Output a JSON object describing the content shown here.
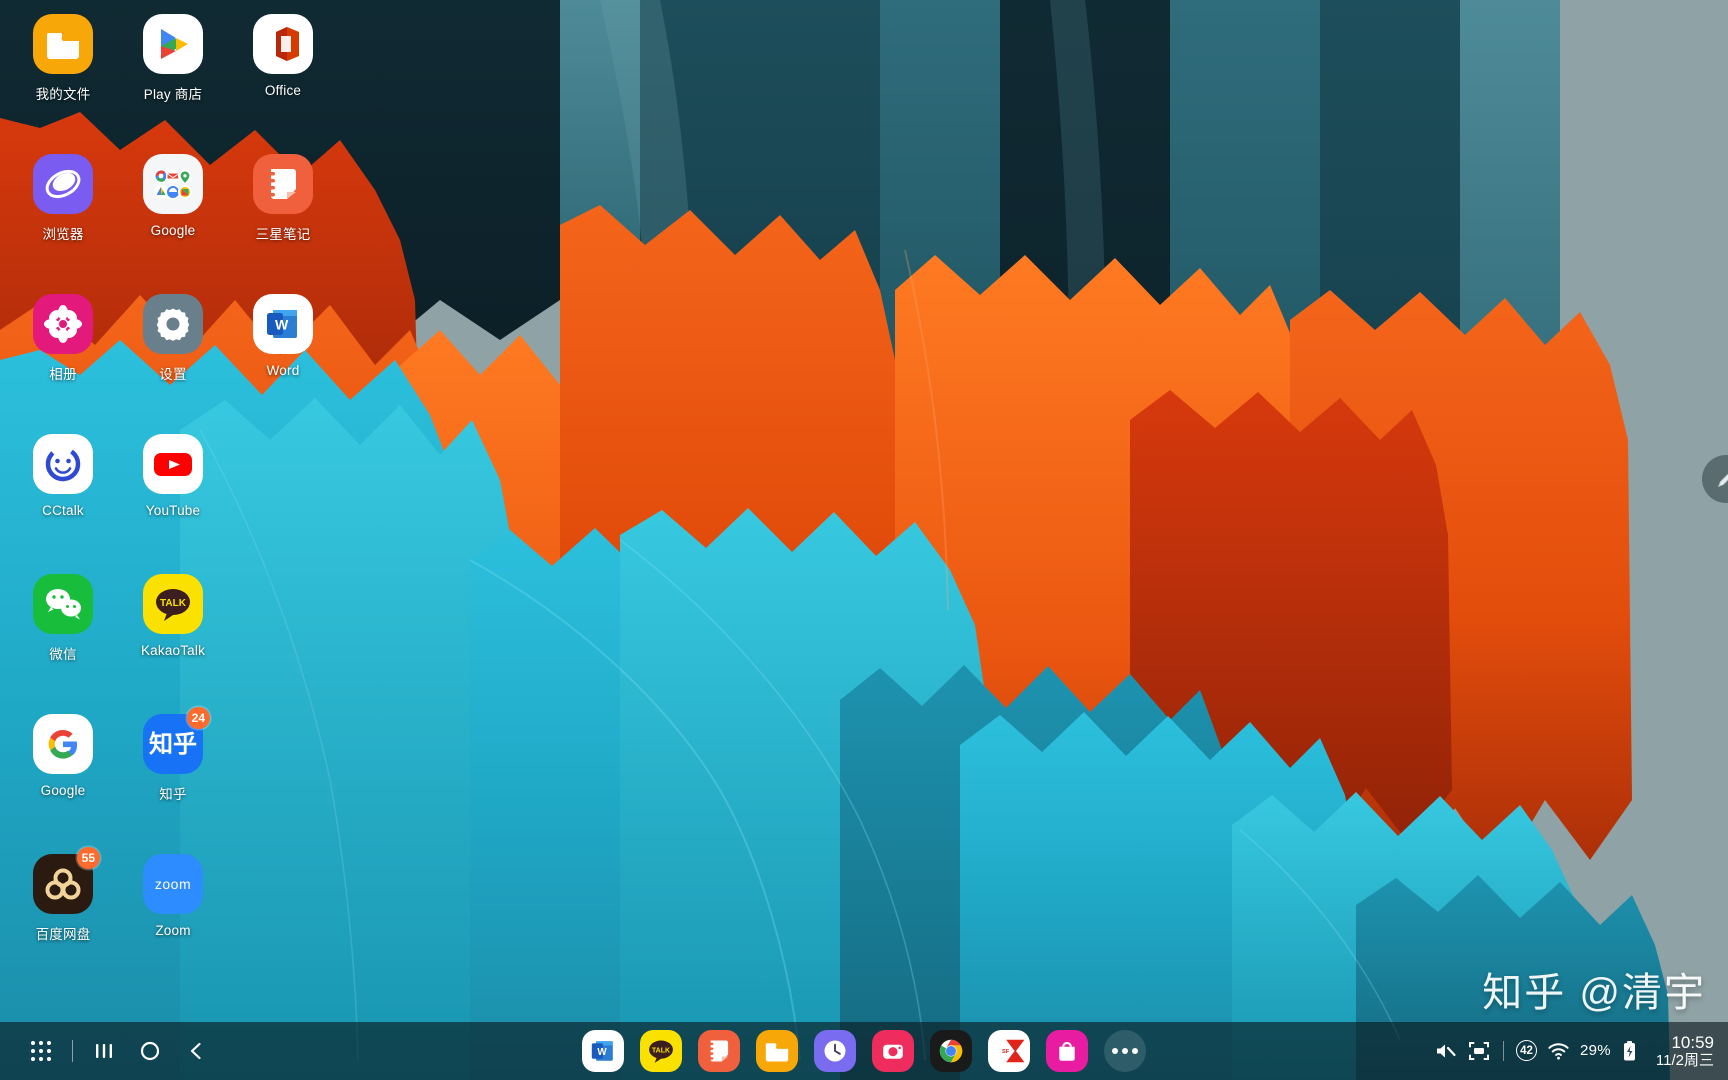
{
  "device": {
    "os": "Samsung One UI tablet home screen",
    "wallpaper_name": "galaxy-tab-abstract-peaks"
  },
  "home_screen": {
    "apps": [
      {
        "label": "我的文件",
        "icon": "my-files-icon",
        "badge": null
      },
      {
        "label": "Play 商店",
        "icon": "play-store-icon",
        "badge": null
      },
      {
        "label": "Office",
        "icon": "office-icon",
        "badge": null
      },
      {
        "label": "浏览器",
        "icon": "samsung-internet-icon",
        "badge": null
      },
      {
        "label": "Google",
        "icon": "google-folder-icon",
        "badge": null
      },
      {
        "label": "三星笔记",
        "icon": "samsung-notes-icon",
        "badge": null
      },
      {
        "label": "相册",
        "icon": "gallery-icon",
        "badge": null
      },
      {
        "label": "设置",
        "icon": "settings-gear-icon",
        "badge": null
      },
      {
        "label": "Word",
        "icon": "word-icon",
        "badge": null
      },
      {
        "label": "CCtalk",
        "icon": "cctalk-icon",
        "badge": null
      },
      {
        "label": "YouTube",
        "icon": "youtube-icon",
        "badge": null
      },
      {
        "label": "",
        "icon": "empty-slot",
        "badge": null
      },
      {
        "label": "微信",
        "icon": "wechat-icon",
        "badge": null
      },
      {
        "label": "KakaoTalk",
        "icon": "kakaotalk-icon",
        "badge": null
      },
      {
        "label": "",
        "icon": "empty-slot",
        "badge": null
      },
      {
        "label": "Google",
        "icon": "google-g-icon",
        "badge": null
      },
      {
        "label": "知乎",
        "icon": "zhihu-icon",
        "badge": "24"
      },
      {
        "label": "",
        "icon": "empty-slot",
        "badge": null
      },
      {
        "label": "百度网盘",
        "icon": "baidu-netdisk-icon",
        "badge": "55"
      },
      {
        "label": "Zoom",
        "icon": "zoom-icon",
        "badge": null
      },
      {
        "label": "",
        "icon": "empty-slot",
        "badge": null
      }
    ]
  },
  "taskbar": {
    "nav": [
      {
        "name": "apps-grid-button",
        "icon": "apps-grid-icon"
      },
      {
        "name": "recents-button",
        "icon": "recents-bars-icon"
      },
      {
        "name": "home-button",
        "icon": "home-circle-icon"
      },
      {
        "name": "back-button",
        "icon": "back-chevron-icon"
      }
    ],
    "pinned_apps": [
      {
        "label": "Word",
        "icon": "word-icon"
      },
      {
        "label": "KakaoTalk",
        "icon": "kakaotalk-icon"
      },
      {
        "label": "三星笔记",
        "icon": "samsung-notes-icon"
      },
      {
        "label": "我的文件",
        "icon": "my-files-icon"
      },
      {
        "label": "时钟",
        "icon": "clock-icon"
      },
      {
        "label": "相机",
        "icon": "camera-icon"
      },
      {
        "label": "Chrome",
        "icon": "chrome-icon"
      },
      {
        "label": "顺丰快递",
        "icon": "sf-express-icon"
      },
      {
        "label": "Galaxy Store",
        "icon": "galaxy-store-icon"
      }
    ],
    "more_button_label": "更多",
    "status": {
      "mute_icon": "volume-muted-icon",
      "screenshot_icon": "screen-capture-icon",
      "notification_count": "42",
      "wifi_icon": "wifi-icon",
      "battery_percent": "29%",
      "battery_icon": "battery-charging-icon",
      "time": "10:59",
      "date": "11/2周三"
    }
  },
  "overlays": {
    "watermark": "知乎 @清宇",
    "spen_handle_icon": "pen-icon"
  },
  "colors": {
    "background": "#8fa2a6",
    "taskbar": "rgba(10,22,28,0.62)",
    "badge": "#ff6b2c",
    "orange_peak": "#ec5a12",
    "teal_peak": "#20a8c8",
    "dark_teal": "#123a45"
  }
}
